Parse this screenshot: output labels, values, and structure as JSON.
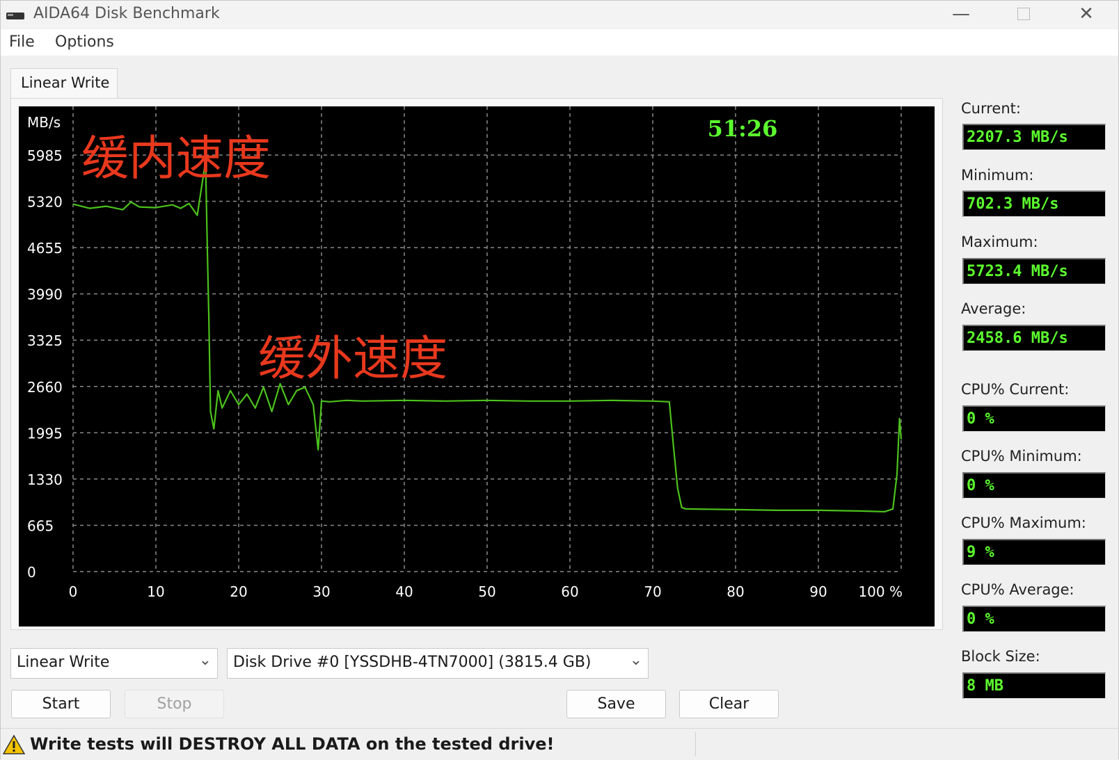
{
  "window": {
    "title": "AIDA64 Disk Benchmark",
    "minimize_glyph": "—",
    "close_glyph": "✕"
  },
  "menu": {
    "file": "File",
    "options": "Options"
  },
  "tab": {
    "label": "Linear Write"
  },
  "chart_data": {
    "type": "line",
    "ylabel": "MB/s",
    "y_ticks": [
      0,
      665,
      1330,
      1995,
      2660,
      3325,
      3990,
      4655,
      5320,
      5985
    ],
    "ylim": [
      0,
      5985
    ],
    "x_ticks": [
      "0",
      "10",
      "20",
      "30",
      "40",
      "50",
      "60",
      "70",
      "80",
      "90",
      "100 %"
    ],
    "xlim": [
      0,
      100
    ],
    "grid": true,
    "timer": "51:26",
    "annotations": [
      "缓内速度",
      "缓外速度"
    ],
    "series": [
      {
        "color": "#4cc21c",
        "x": [
          0,
          2,
          4,
          6,
          7,
          8,
          10,
          12,
          13,
          14,
          15,
          16,
          16.2,
          16.4,
          16.6,
          17,
          17.5,
          18,
          19,
          20,
          21,
          22,
          23,
          24,
          25,
          26,
          27,
          28,
          29,
          29.6,
          30,
          31,
          33,
          35,
          40,
          45,
          50,
          55,
          60,
          65,
          70,
          72,
          72.5,
          73,
          73.5,
          74,
          80,
          85,
          90,
          95,
          98,
          99,
          99.5,
          99.8,
          100
        ],
        "y": [
          5280,
          5220,
          5250,
          5200,
          5310,
          5240,
          5230,
          5270,
          5220,
          5290,
          5120,
          5900,
          4700,
          3600,
          2300,
          2050,
          2600,
          2350,
          2600,
          2400,
          2550,
          2350,
          2650,
          2300,
          2700,
          2400,
          2600,
          2650,
          2400,
          1750,
          2450,
          2440,
          2460,
          2450,
          2460,
          2450,
          2460,
          2450,
          2450,
          2460,
          2450,
          2440,
          1800,
          1200,
          920,
          900,
          890,
          880,
          880,
          870,
          860,
          900,
          1400,
          2200,
          1900
        ]
      }
    ]
  },
  "stats": {
    "current_label": "Current:",
    "current_value": "2207.3 MB/s",
    "minimum_label": "Minimum:",
    "minimum_value": "702.3 MB/s",
    "maximum_label": "Maximum:",
    "maximum_value": "5723.4 MB/s",
    "average_label": "Average:",
    "average_value": "2458.6 MB/s",
    "cpu_current_label": "CPU% Current:",
    "cpu_current_value": "0 %",
    "cpu_minimum_label": "CPU% Minimum:",
    "cpu_minimum_value": "0 %",
    "cpu_maximum_label": "CPU% Maximum:",
    "cpu_maximum_value": "9 %",
    "cpu_average_label": "CPU% Average:",
    "cpu_average_value": "0 %",
    "block_size_label": "Block Size:",
    "block_size_value": "8 MB"
  },
  "controls": {
    "test_select": "Linear Write",
    "drive_select": "Disk Drive #0  [YSSDHB-4TN7000]  (3815.4 GB)",
    "chevron": "⌄",
    "start": "Start",
    "stop": "Stop",
    "save": "Save",
    "clear": "Clear"
  },
  "status": {
    "warning": "Write tests will DESTROY ALL DATA on the tested drive!"
  },
  "colors": {
    "chart_bg": "#000000",
    "line": "#4cc21c",
    "grid": "#8a8a8a",
    "timer": "#5cff2e",
    "annotation": "#e8381d",
    "value_text": "#5cff2e"
  }
}
